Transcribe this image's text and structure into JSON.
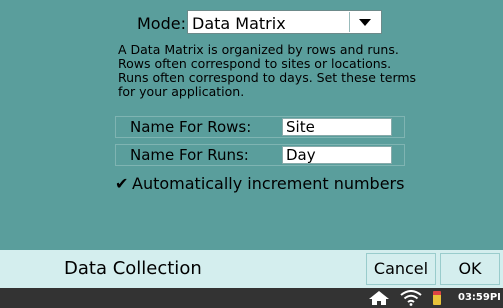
{
  "mode": {
    "label": "Mode:",
    "selected": "Data Matrix"
  },
  "description": "A Data Matrix is organized by rows and runs. Rows often correspond to sites or locations. Runs often correspond to days. Set these terms for your application.",
  "rows_field": {
    "label": "Name For Rows:",
    "value": "Site"
  },
  "runs_field": {
    "label": "Name For Runs:",
    "value": "Day"
  },
  "auto_increment": {
    "checked": true,
    "mark": "✔",
    "label": "Automatically increment numbers"
  },
  "footer": {
    "title": "Data Collection",
    "cancel_label": "Cancel",
    "ok_label": "OK"
  },
  "statusbar": {
    "home_icon": "⌂",
    "wifi_icon": "wifi",
    "battery_icon": "battery",
    "time": "03:59PI"
  },
  "colors": {
    "background": "#5a9e9c",
    "footer": "#d4eeee",
    "statusbar": "#333333"
  }
}
